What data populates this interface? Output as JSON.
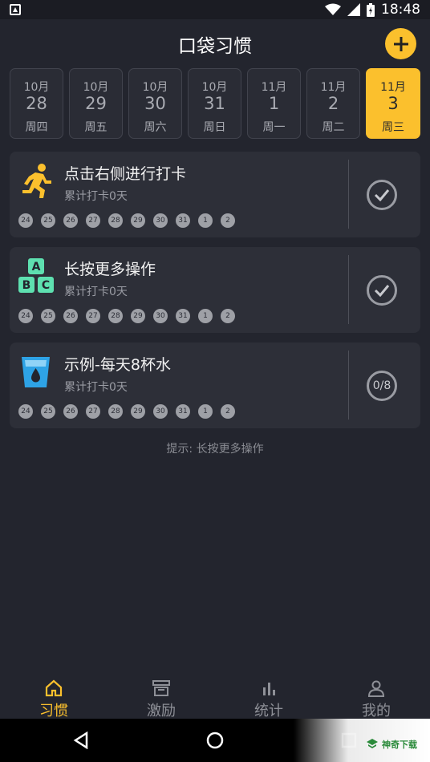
{
  "status_bar": {
    "time": "18:48"
  },
  "header": {
    "title": "口袋习惯",
    "add_icon": "plus-icon",
    "accent": "#fbc02d"
  },
  "dates": [
    {
      "month": "10月",
      "day": "28",
      "weekday": "周四",
      "active": false
    },
    {
      "month": "10月",
      "day": "29",
      "weekday": "周五",
      "active": false
    },
    {
      "month": "10月",
      "day": "30",
      "weekday": "周六",
      "active": false
    },
    {
      "month": "10月",
      "day": "31",
      "weekday": "周日",
      "active": false
    },
    {
      "month": "11月",
      "day": "1",
      "weekday": "周一",
      "active": false
    },
    {
      "month": "11月",
      "day": "2",
      "weekday": "周二",
      "active": false
    },
    {
      "month": "11月",
      "day": "3",
      "weekday": "周三",
      "active": true
    }
  ],
  "habits": [
    {
      "name": "点击右侧进行打卡",
      "total": "累计打卡0天",
      "icon": "running-person-icon",
      "action": "check",
      "action_text": "",
      "days": [
        "24",
        "25",
        "26",
        "27",
        "28",
        "29",
        "30",
        "31",
        "1",
        "2"
      ]
    },
    {
      "name": "长按更多操作",
      "total": "累计打卡0天",
      "icon": "abc-blocks-icon",
      "action": "check",
      "action_text": "",
      "days": [
        "24",
        "25",
        "26",
        "27",
        "28",
        "29",
        "30",
        "31",
        "1",
        "2"
      ]
    },
    {
      "name": "示例-每天8杯水",
      "total": "累计打卡0天",
      "icon": "water-glass-icon",
      "action": "count",
      "action_text": "0/8",
      "days": [
        "24",
        "25",
        "26",
        "27",
        "28",
        "29",
        "30",
        "31",
        "1",
        "2"
      ]
    }
  ],
  "hint": "提示: 长按更多操作",
  "bottom_nav": [
    {
      "label": "习惯",
      "icon": "home-icon",
      "active": true
    },
    {
      "label": "激励",
      "icon": "reward-icon",
      "active": false
    },
    {
      "label": "统计",
      "icon": "bar-chart-icon",
      "active": false
    },
    {
      "label": "我的",
      "icon": "person-icon",
      "active": false
    }
  ],
  "watermark": {
    "text": "神奇下载"
  }
}
